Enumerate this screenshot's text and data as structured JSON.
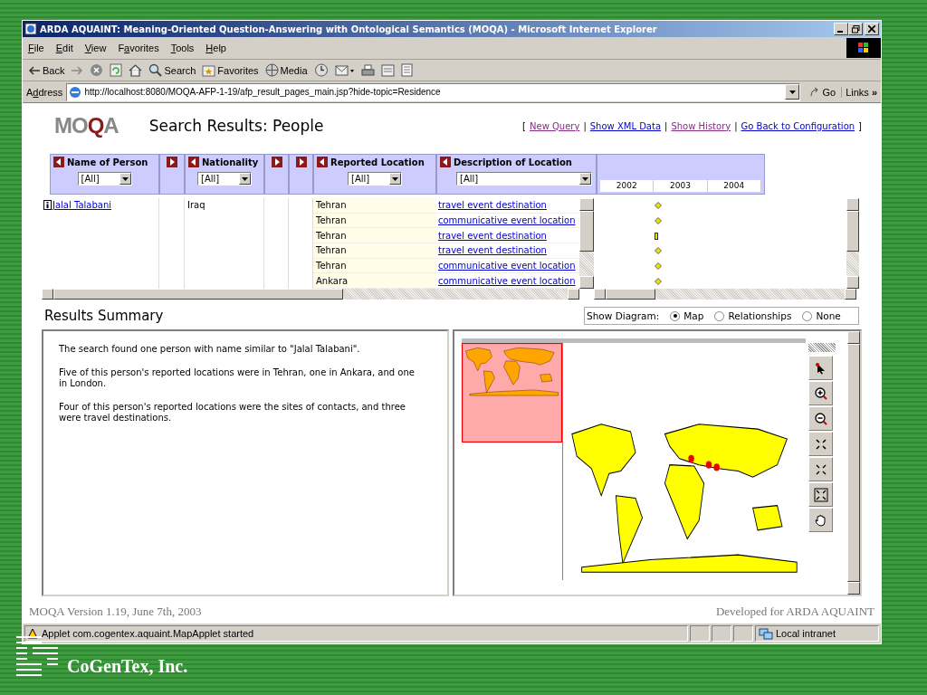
{
  "window": {
    "title": "ARDA AQUAINT: Meaning-Oriented Question-Answering with Ontological Semantics (MOQA) - Microsoft Internet Explorer"
  },
  "menu": [
    {
      "key": "F",
      "rest": "ile"
    },
    {
      "key": "E",
      "rest": "dit"
    },
    {
      "key": "V",
      "rest": "iew"
    },
    {
      "key": "a",
      "rest": "vorites",
      "pre": "F"
    },
    {
      "key": "T",
      "rest": "ools"
    },
    {
      "key": "H",
      "rest": "elp"
    }
  ],
  "toolbar": [
    {
      "kind": "back",
      "label": "Back"
    },
    {
      "kind": "forward"
    },
    {
      "kind": "stop"
    },
    {
      "kind": "refresh"
    },
    {
      "kind": "home"
    },
    {
      "kind": "search",
      "label": "Search"
    },
    {
      "kind": "favorites",
      "label": "Favorites"
    },
    {
      "kind": "media",
      "label": "Media"
    },
    {
      "kind": "history"
    },
    {
      "kind": "mail"
    },
    {
      "kind": "print"
    },
    {
      "kind": "edit"
    },
    {
      "kind": "discuss"
    }
  ],
  "address": {
    "pre": "A",
    "key": "d",
    "rest": "dress",
    "value": "http://localhost:8080/MOQA-AFP-1-19/afp_result_pages_main.jsp?hide-topic=Residence",
    "go": "Go",
    "links": "Links",
    "more": "»"
  },
  "page": {
    "logo": [
      {
        "text": "MO",
        "accent": false
      },
      {
        "text": "Q",
        "accent": true
      },
      {
        "text": "A",
        "accent": false
      }
    ],
    "heading": "Search Results: People",
    "nav": {
      "open": "[",
      "close": "]",
      "links": [
        {
          "label": "New Query",
          "visited": true
        },
        {
          "label": "Show XML Data",
          "visited": false,
          "sep": "|"
        },
        {
          "label": "Show History",
          "visited": true,
          "sep": "|"
        },
        {
          "label": "Go Back to Configuration",
          "visited": false,
          "sep": "|"
        }
      ]
    },
    "columns": [
      {
        "kind": "field",
        "label": "Name of Person",
        "filter": "[All]"
      },
      {
        "kind": "expand"
      },
      {
        "kind": "field",
        "label": "Nationality",
        "filter": "[All]"
      },
      {
        "kind": "expand"
      },
      {
        "kind": "expand"
      },
      {
        "kind": "field",
        "label": "Reported Location",
        "filter": "[All]"
      },
      {
        "kind": "field",
        "label": "Description of Location",
        "filter": "[All]"
      }
    ],
    "person": {
      "name": "Jalal Talabani",
      "nationality": "Iraq"
    },
    "rows": [
      {
        "location": "Tehran",
        "description": "travel event destination",
        "kind": "diamond"
      },
      {
        "location": "Tehran",
        "description": "communicative event location",
        "kind": "diamond"
      },
      {
        "location": "Tehran",
        "description": "travel event destination",
        "kind": "bar"
      },
      {
        "location": "Tehran",
        "description": "travel event destination",
        "kind": "diamond"
      },
      {
        "location": "Tehran",
        "description": "communicative event location",
        "kind": "diamond"
      },
      {
        "location": "Ankara",
        "description": "communicative event location",
        "kind": "diamond"
      }
    ],
    "years": [
      "2002",
      "2003",
      "2004"
    ],
    "summary_title": "Results Summary",
    "diagram": {
      "label": "Show Diagram:",
      "options": [
        {
          "label": "Map",
          "selected": true
        },
        {
          "label": "Relationships",
          "selected": false
        },
        {
          "label": "None",
          "selected": false
        }
      ]
    },
    "summary": [
      "The search found one person with name similar to \"Jalal Talabani\".",
      "Five of this person's reported locations were in Tehran, one in Ankara, and one in London.",
      "Four of this person's reported locations were the sites of contacts, and three were travel destinations."
    ],
    "map_tools": [
      {
        "kind": "pointer"
      },
      {
        "kind": "zoom-in"
      },
      {
        "kind": "zoom-out"
      },
      {
        "kind": "shrink"
      },
      {
        "kind": "expand"
      },
      {
        "kind": "full-extent"
      },
      {
        "kind": "pan"
      }
    ],
    "version": "MOQA Version 1.19, June 7th, 2003",
    "developed": "Developed for ARDA AQUAINT"
  },
  "status_bar": {
    "text": "Applet com.cogentex.aquaint.MapApplet started",
    "zone": "Local intranet"
  },
  "slide": {
    "company": "CoGenTex, Inc."
  }
}
